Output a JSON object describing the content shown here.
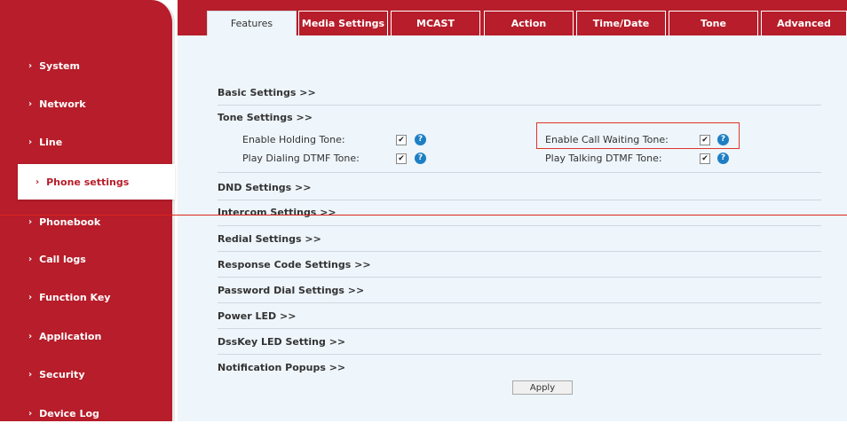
{
  "tabs": [
    "Features",
    "Media Settings",
    "MCAST",
    "Action",
    "Time/Date",
    "Tone",
    "Advanced"
  ],
  "sidebar": {
    "items": [
      {
        "label": "System"
      },
      {
        "label": "Network"
      },
      {
        "label": "Line"
      },
      {
        "label": "Phone settings"
      },
      {
        "label": "Phonebook"
      },
      {
        "label": "Call logs"
      },
      {
        "label": "Function Key"
      },
      {
        "label": "Application"
      },
      {
        "label": "Security"
      },
      {
        "label": "Device Log"
      }
    ],
    "chevron": "›"
  },
  "sections": {
    "basic": "Basic Settings >>",
    "tone": "Tone Settings >>",
    "dnd": "DND Settings >>",
    "intercom": "Intercom Settings >>",
    "redial": "Redial Settings >>",
    "response": "Response Code Settings >>",
    "password": "Password Dial Settings >>",
    "power": "Power LED >>",
    "dsskey": "DssKey LED Setting >>",
    "notification": "Notification Popups >>"
  },
  "tone_settings": {
    "holding": "Enable Holding Tone:",
    "call_waiting": "Enable Call Waiting Tone:",
    "dialing_dtmf": "Play Dialing DTMF Tone:",
    "talking_dtmf": "Play Talking DTMF Tone:",
    "checked": "✔",
    "help": "?"
  },
  "apply_label": "Apply",
  "colors": {
    "brand": "#b71d2a",
    "panel": "#eef5fb",
    "help": "#1e7fc4",
    "highlight": "#e0362b"
  }
}
